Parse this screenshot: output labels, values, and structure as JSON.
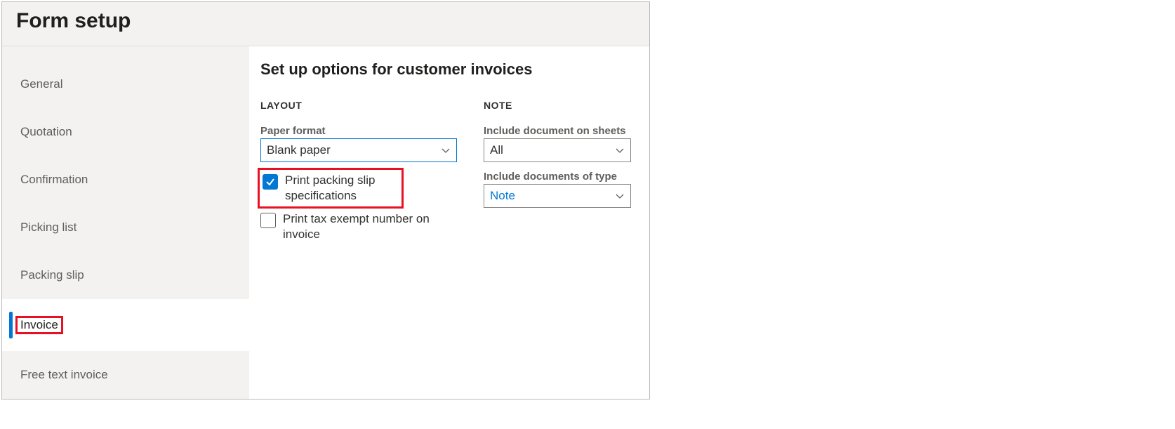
{
  "title": "Form setup",
  "sidebar": {
    "items": [
      {
        "label": "General"
      },
      {
        "label": "Quotation"
      },
      {
        "label": "Confirmation"
      },
      {
        "label": "Picking list"
      },
      {
        "label": "Packing slip"
      },
      {
        "label": "Invoice",
        "active": true,
        "highlight": true
      },
      {
        "label": "Free text invoice"
      }
    ]
  },
  "content": {
    "heading": "Set up options for customer invoices",
    "layout": {
      "section_label": "LAYOUT",
      "paper_format_label": "Paper format",
      "paper_format_value": "Blank paper",
      "print_packing_slip_label": "Print packing slip specifications",
      "print_packing_slip_checked": true,
      "print_tax_exempt_label": "Print tax exempt number on invoice",
      "print_tax_exempt_checked": false
    },
    "note": {
      "section_label": "NOTE",
      "include_doc_sheets_label": "Include document on sheets",
      "include_doc_sheets_value": "All",
      "include_doc_type_label": "Include documents of type",
      "include_doc_type_value": "Note"
    }
  }
}
